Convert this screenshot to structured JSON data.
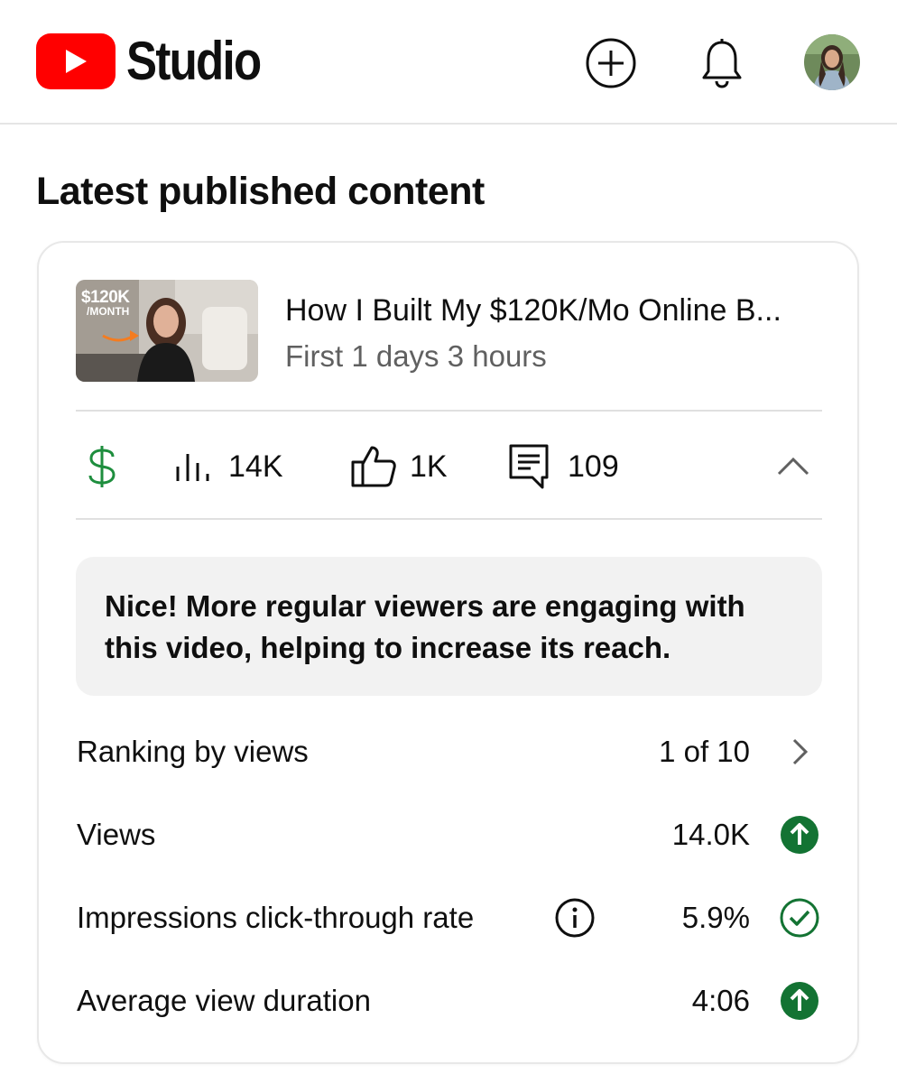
{
  "app": {
    "name": "Studio",
    "brand_color": "#ff0000"
  },
  "header": {
    "create_icon": "add-circle-icon",
    "notifications_icon": "bell-icon",
    "avatar": "profile-avatar"
  },
  "section": {
    "title": "Latest published content"
  },
  "video": {
    "thumbnail_badge_top": "$120K",
    "thumbnail_badge_bottom": "/MONTH",
    "title": "How I Built My $120K/Mo Online B...",
    "subtitle": "First 1 days 3 hours"
  },
  "stats": {
    "monetization_icon": "dollar-icon",
    "monetization_color": "#1e8e3e",
    "views": "14K",
    "likes": "1K",
    "comments": "109"
  },
  "insight": {
    "text": "Nice! More regular viewers are engaging with this video, helping to increase its reach."
  },
  "metrics": [
    {
      "label": "Ranking by views",
      "value": "1 of 10",
      "status_icon": "chevron-right-icon"
    },
    {
      "label": "Views",
      "value": "14.0K",
      "status_icon": "arrow-up-circle-icon",
      "status_color": "#137333"
    },
    {
      "label": "Impressions click-through rate",
      "value": "5.9%",
      "status_icon": "check-circle-icon",
      "status_color": "#137333",
      "info_icon": "info-icon"
    },
    {
      "label": "Average view duration",
      "value": "4:06",
      "status_icon": "arrow-up-circle-icon",
      "status_color": "#137333"
    }
  ]
}
